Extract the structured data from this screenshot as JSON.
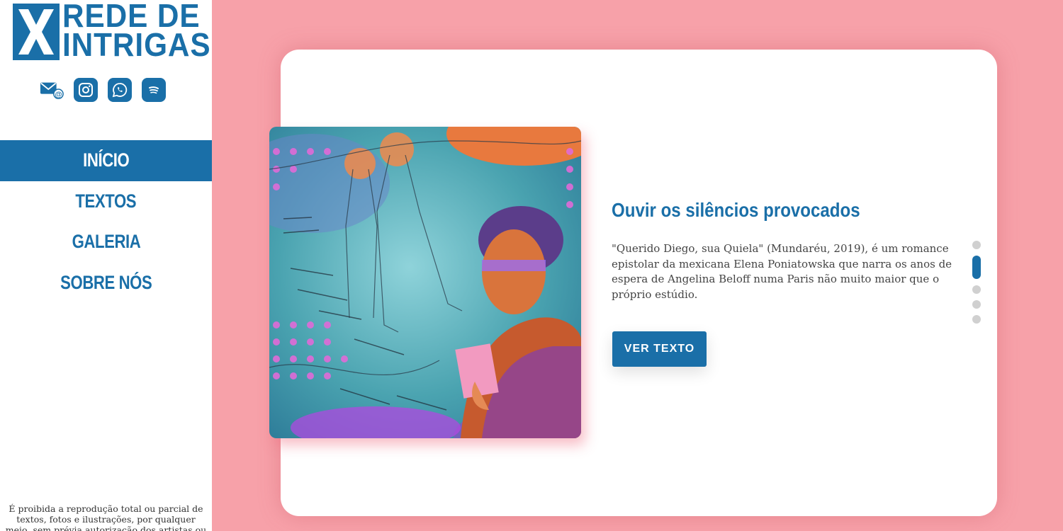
{
  "brand": {
    "logo_line1": "REDE DE",
    "logo_line2": "INTRIGAS",
    "primary_color": "#1a6fa8",
    "background_color": "#f7a1a9"
  },
  "social": [
    {
      "icon": "email-icon"
    },
    {
      "icon": "instagram-icon"
    },
    {
      "icon": "whatsapp-icon"
    },
    {
      "icon": "spotify-icon"
    }
  ],
  "nav": {
    "items": [
      {
        "label": "INÍCIO",
        "active": true
      },
      {
        "label": "TEXTOS",
        "active": false
      },
      {
        "label": "GALERIA",
        "active": false
      },
      {
        "label": "SOBRE NÓS",
        "active": false
      }
    ]
  },
  "footer": {
    "note": "É proibida a reprodução total ou parcial de textos, fotos e ilustrações, por qualquer meio, sem prévia autorização dos artistas ou dos"
  },
  "slide": {
    "title": "Ouvir os silêncios provocados",
    "description": "\"Querido Diego, sua Quiela\" (Mundaréu, 2019), é um romance epistolar da mexicana Elena Poniatowska que narra os anos de espera de Angelina Beloff numa Paris não muito maior que o próprio estúdio.",
    "button_label": "VER TEXTO"
  },
  "carousel": {
    "total": 5,
    "active_index": 1
  }
}
